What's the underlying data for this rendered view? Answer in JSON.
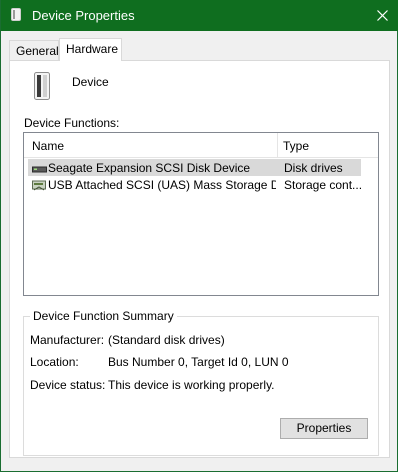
{
  "window": {
    "title": "Device Properties"
  },
  "tabs": [
    {
      "label": "General"
    },
    {
      "label": "Hardware"
    }
  ],
  "device": {
    "name": "Device"
  },
  "functions": {
    "label": "Device Functions:",
    "columns": {
      "name": "Name",
      "type": "Type"
    },
    "rows": [
      {
        "name": "Seagate Expansion SCSI Disk Device",
        "type": "Disk drives",
        "icon": "disk-drive-icon",
        "selected": true
      },
      {
        "name": "USB Attached SCSI (UAS) Mass Storage Dev...",
        "type": "Storage cont...",
        "icon": "storage-controller-icon",
        "selected": false
      }
    ]
  },
  "summary": {
    "legend": "Device Function Summary",
    "manufacturer_label": "Manufacturer:",
    "manufacturer": "(Standard disk drives)",
    "location_label": "Location:",
    "location": "Bus Number 0, Target Id 0, LUN 0",
    "status_label": "Device status:",
    "status": "This device is working properly.",
    "properties_button": "Properties"
  },
  "colors": {
    "titlebar": "#0f6e1f",
    "selection": "#d9d9d9"
  }
}
